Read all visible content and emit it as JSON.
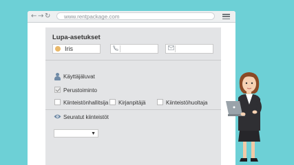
{
  "browser": {
    "url": "www.rentpackage.com",
    "nav": {
      "back": "←",
      "forward": "→",
      "reload": "↻"
    }
  },
  "page": {
    "title": "Lupa-asetukset",
    "fields": {
      "name_value": "Iris",
      "phone_value": "",
      "email_value": ""
    },
    "permissions": {
      "heading": "Käyttäjäluvat",
      "basic_label": "Perustoiminto",
      "basic_checked": true,
      "options": [
        {
          "label": "Kiinteistönhallitsija",
          "checked": false
        },
        {
          "label": "Kirjanpitäjä",
          "checked": false
        },
        {
          "label": "Kiinteistöhuoltaja",
          "checked": false
        }
      ]
    },
    "followed": {
      "heading": "Seuratut kiinteistöt",
      "selected": ""
    }
  },
  "colors": {
    "background": "#6dd0d6",
    "panel": "#e3e4e6",
    "icon_blue": "#6f8aa6"
  }
}
